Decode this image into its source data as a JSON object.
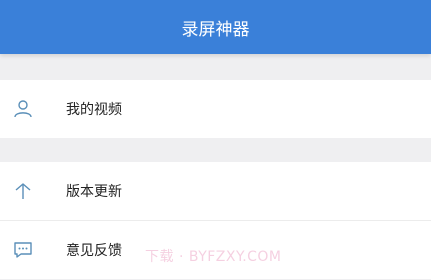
{
  "header": {
    "title": "录屏神器"
  },
  "menu": {
    "items": [
      {
        "label": "我的视频",
        "icon": "user-icon"
      },
      {
        "label": "版本更新",
        "icon": "upload-arrow-icon"
      },
      {
        "label": "意见反馈",
        "icon": "feedback-icon"
      }
    ]
  },
  "watermark": {
    "text": "下载 · BYFZXY.COM"
  },
  "colors": {
    "header_bg": "#3a80d9",
    "icon": "#5a8fb8",
    "page_bg": "#efeff1"
  }
}
